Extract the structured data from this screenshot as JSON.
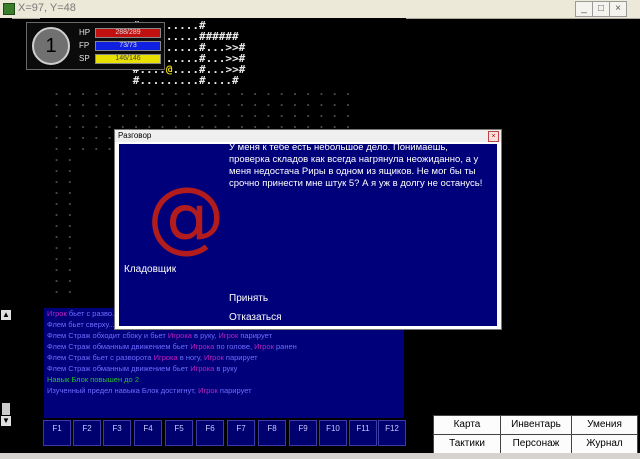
{
  "window": {
    "title": "X=97, Y=48",
    "min": "_",
    "max": "□",
    "close": "×"
  },
  "map": {
    "rows": [
      "              #.........#",
      "              #.........######",
      "              #.........#...>>#",
      "              #.........#...>>#",
      "              #....@....#...>>#",
      "              #.........#....#"
    ],
    "player_glyph": "@"
  },
  "status": {
    "level": "1",
    "hp_label": "HP",
    "hp_value": "288/289",
    "fp_label": "FP",
    "fp_value": "73/73",
    "sp_label": "SP",
    "sp_value": "146/146"
  },
  "log": [
    {
      "who": "Игрок",
      "text": " бьет с разво..."
    },
    {
      "who": "Флем",
      "text": " бьет сверху..."
    },
    {
      "who": "Флем Страж",
      "text": " обходит сбоку и бьет ",
      "who2": "Игрока",
      "text2": " в руку, ",
      "who3": "Игрок",
      "text3": " парирует"
    },
    {
      "who": "Флем Страж",
      "text": " обманным движением бьет ",
      "who2": "Игрока",
      "text2": " по голове, ",
      "who3": "Игрок",
      "text3": " ранен"
    },
    {
      "who": "Флем Страж",
      "text": " бьет с разворота ",
      "who2": "Игрока",
      "text2": " в ногу, ",
      "who3": "Игрок",
      "text3": " парирует"
    },
    {
      "who": "Флем Страж",
      "text": " обманным движением бьет ",
      "who2": "Игрока",
      "text2": " в руку",
      "who3": "",
      "text3": ""
    },
    {
      "sys": "Навык Блок повышен до 2"
    },
    {
      "who": "Изученный предел навыка Блок достигнут, ",
      "text": "",
      "who2": "Игрок",
      "text2": " парирует",
      "who3": "",
      "text3": ""
    }
  ],
  "fkeys": [
    "F1",
    "F2",
    "F3",
    "F4",
    "F5",
    "F6",
    "F7",
    "F8",
    "F9",
    "F10",
    "F11",
    "F12"
  ],
  "commands": {
    "map": "Карта",
    "inventory": "Инвентарь",
    "skills": "Умения",
    "tactics": "Тактики",
    "character": "Персонаж",
    "journal": "Журнал"
  },
  "dialog": {
    "title": "Разговор",
    "close": "×",
    "portrait_glyph": "@",
    "npc_name": "Кладовщик",
    "speech": "У меня к тебе есть небольшое дело. Понимаешь, проверка складов как всегда нагрянула неожиданно, а у меня недостача Риры в одном из ящиков. Не мог бы ты срочно принести мне штук 5? А я уж в долгу не останусь!",
    "accept": "Принять",
    "refuse": "Отказаться"
  },
  "colors": {
    "panel_blue": "#00007a",
    "portrait_red": "#b21c1c",
    "player_yellow": "#e8d400",
    "hp": "#c01010",
    "fp": "#1020e0",
    "sp": "#e8e000"
  }
}
